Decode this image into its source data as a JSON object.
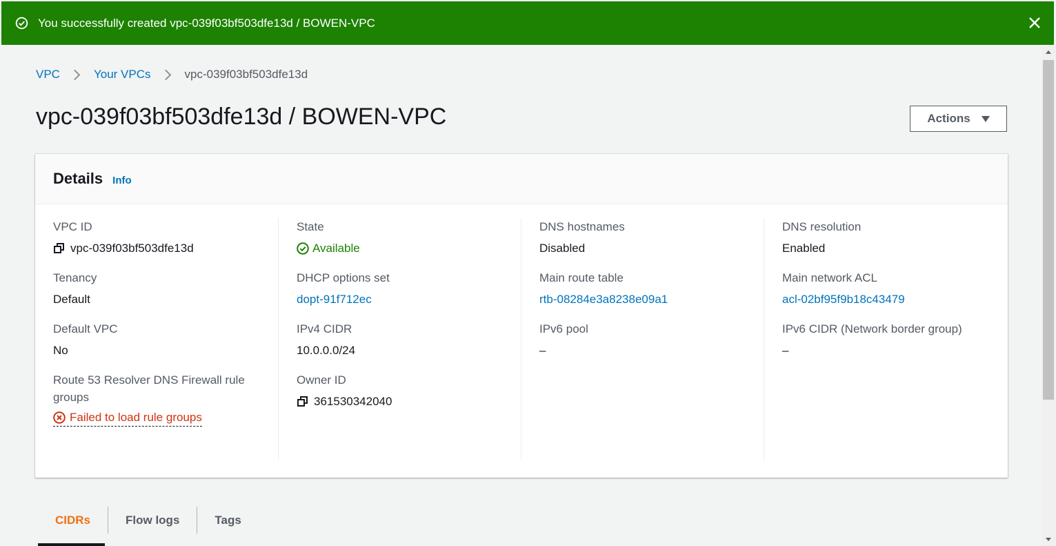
{
  "banner": {
    "message": "You successfully created vpc-039f03bf503dfe13d / BOWEN-VPC",
    "color": "#1d8102"
  },
  "breadcrumb": [
    {
      "label": "VPC"
    },
    {
      "label": "Your VPCs"
    },
    {
      "label": "vpc-039f03bf503dfe13d"
    }
  ],
  "page_title": "vpc-039f03bf503dfe13d / BOWEN-VPC",
  "actions_label": "Actions",
  "details": {
    "title": "Details",
    "info_label": "Info",
    "vpc_id": {
      "label": "VPC ID",
      "value": "vpc-039f03bf503dfe13d"
    },
    "tenancy": {
      "label": "Tenancy",
      "value": "Default"
    },
    "default_vpc": {
      "label": "Default VPC",
      "value": "No"
    },
    "firewall": {
      "label": "Route 53 Resolver DNS Firewall rule groups",
      "value": "Failed to load rule groups"
    },
    "state": {
      "label": "State",
      "value": "Available"
    },
    "dhcp": {
      "label": "DHCP options set",
      "value": "dopt-91f712ec"
    },
    "ipv4_cidr": {
      "label": "IPv4 CIDR",
      "value": "10.0.0.0/24"
    },
    "owner_id": {
      "label": "Owner ID",
      "value": "361530342040"
    },
    "dns_hostnames": {
      "label": "DNS hostnames",
      "value": "Disabled"
    },
    "main_route_table": {
      "label": "Main route table",
      "value": "rtb-08284e3a8238e09a1"
    },
    "ipv6_pool": {
      "label": "IPv6 pool",
      "value": "–"
    },
    "dns_resolution": {
      "label": "DNS resolution",
      "value": "Enabled"
    },
    "main_network_acl": {
      "label": "Main network ACL",
      "value": "acl-02bf95f9b18c43479"
    },
    "ipv6_cidr": {
      "label": "IPv6 CIDR (Network border group)",
      "value": "–"
    }
  },
  "tabs": [
    {
      "label": "CIDRs",
      "active": true
    },
    {
      "label": "Flow logs"
    },
    {
      "label": "Tags"
    }
  ]
}
